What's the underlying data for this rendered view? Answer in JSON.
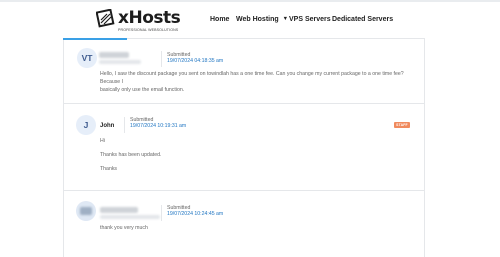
{
  "brand": {
    "name": "xHosts",
    "tagline": "PROFESSIONAL WEBSOLUTIONS"
  },
  "nav": {
    "items": [
      {
        "label": "Home"
      },
      {
        "label": "Web Hosting"
      },
      {
        "label": "VPS Servers"
      },
      {
        "label": "Dedicated Servers"
      }
    ]
  },
  "replies": [
    {
      "avatar_initials": "VT",
      "submitted_label": "Submitted",
      "submitted_date": "19/07/2024 04:18:35 am",
      "body_lines": [
        "Hello, I saw the discount package you sent on towindlah has a one time fee. Can you change my current package to a one time fee? Because I",
        "basically only use the email function."
      ]
    },
    {
      "avatar_initials": "J",
      "name": "John",
      "submitted_label": "Submitted",
      "submitted_date": "19/07/2024 10:19:31 am",
      "badge": "STAFF",
      "body_lines": [
        "Hi",
        "Thanks has been updated.",
        "Thanks"
      ]
    },
    {
      "submitted_label": "Submitted",
      "submitted_date": "19/07/2024 10:24:45 am",
      "body_lines": [
        "thank you very much"
      ]
    }
  ],
  "colors": {
    "accent": "#3aa0e6",
    "link": "#1f75c2",
    "staff_badge": "#f08a5d"
  }
}
